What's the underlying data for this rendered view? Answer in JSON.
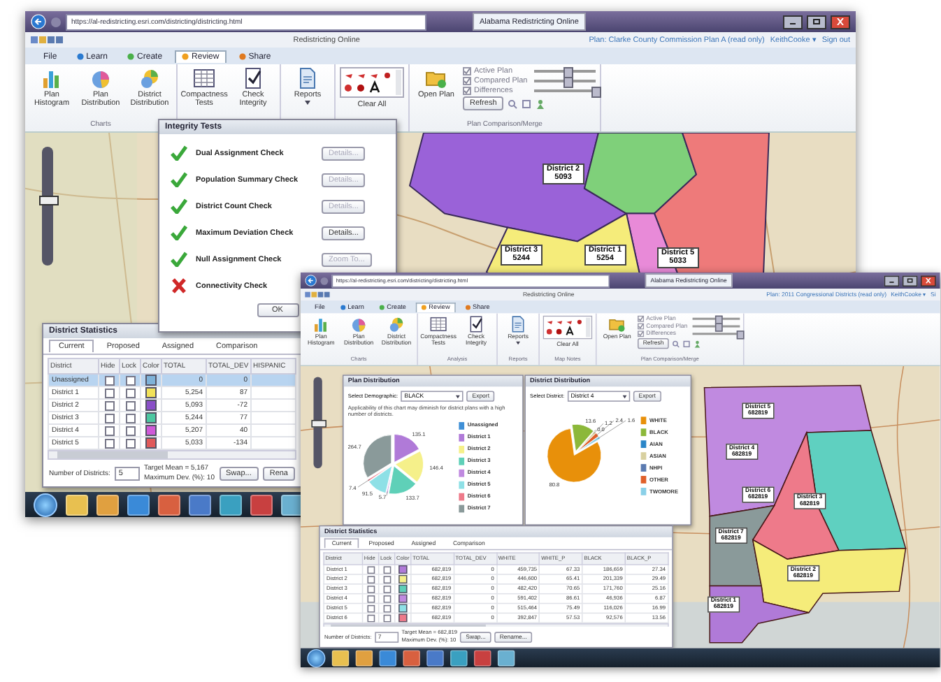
{
  "windows": [
    {
      "url": "https://al-redistricting.esri.com/districting/districting.html",
      "tab": "Alabama Redistricting Online",
      "app_title": "Redistricting Online",
      "plan": "Plan: Clarke County Commission Plan A (read only)",
      "user": "KeithCooke ▾",
      "sign_out": "Sign out",
      "menu": [
        {
          "label": "File",
          "selected": false
        },
        {
          "label": "Learn",
          "selected": false
        },
        {
          "label": "Create",
          "selected": false
        },
        {
          "label": "Review",
          "selected": true
        },
        {
          "label": "Share",
          "selected": false
        }
      ],
      "ribbon": [
        {
          "kind": "buttons",
          "group": "Charts",
          "buttons": [
            {
              "label": "Plan Histogram",
              "kind": "histogram"
            },
            {
              "label": "Plan Distribution",
              "kind": "pie"
            },
            {
              "label": "District Distribution",
              "kind": "pie-stack"
            }
          ]
        },
        {
          "kind": "buttons",
          "buttons": [
            {
              "label": "Compactness Tests",
              "kind": "table"
            },
            {
              "label": "Check Integrity",
              "kind": "check"
            }
          ]
        },
        {
          "kind": "buttons",
          "buttons": [
            {
              "label": "Reports",
              "kind": "report"
            }
          ]
        },
        {
          "kind": "notes",
          "clear": "Clear All"
        },
        {
          "kind": "compare",
          "group": "Plan Comparison/Merge",
          "open": "Open Plan",
          "refresh": "Refresh",
          "layers": [
            {
              "label": "Active Plan",
              "checked": true,
              "level": 0.55
            },
            {
              "label": "Compared Plan",
              "checked": true,
              "level": 0.55
            },
            {
              "label": "Differences",
              "checked": true,
              "level": 1
            }
          ]
        }
      ],
      "map": {
        "zoom": {
          "level": 0.55
        },
        "labels": [
          {
            "name": "District 2",
            "population": "5093"
          },
          {
            "name": "District 3",
            "population": "5244"
          },
          {
            "name": "District 1",
            "population": "5254"
          },
          {
            "name": "District 5",
            "population": "5033"
          }
        ]
      },
      "dialog": {
        "title": "Integrity Tests",
        "ok": "OK",
        "checks": [
          {
            "label": "Dual Assignment Check",
            "passed": true,
            "button": {
              "label": "Details...",
              "disabled": true
            }
          },
          {
            "label": "Population Summary Check",
            "passed": true,
            "button": {
              "label": "Details...",
              "disabled": true
            }
          },
          {
            "label": "District Count Check",
            "passed": true,
            "button": {
              "label": "Details...",
              "disabled": true
            }
          },
          {
            "label": "Maximum Deviation Check",
            "passed": true,
            "button": {
              "label": "Details...",
              "disabled": false
            }
          },
          {
            "label": "Null Assignment Check",
            "passed": true,
            "button": {
              "label": "Zoom To...",
              "disabled": true
            }
          },
          {
            "label": "Connectivity Check",
            "passed": false
          }
        ]
      },
      "stats": {
        "title": "District Statistics",
        "tabs": [
          {
            "label": "Current",
            "selected": true
          },
          {
            "label": "Proposed",
            "selected": false
          },
          {
            "label": "Assigned",
            "selected": false
          },
          {
            "label": "Comparison",
            "selected": false
          }
        ],
        "columns": [
          "District",
          "Hide",
          "Lock",
          "Color",
          "TOTAL",
          "TOTAL_DEV",
          "HISPANIC"
        ],
        "rows": [
          {
            "district": "Unassigned",
            "hide": false,
            "lock": false,
            "color": "#7fb2d8",
            "selected": true,
            "values": [
              "0",
              "0"
            ]
          },
          {
            "district": "District 1",
            "hide": false,
            "lock": false,
            "color": "#f2e25a",
            "selected": false,
            "values": [
              "5,254",
              "87"
            ]
          },
          {
            "district": "District 2",
            "hide": false,
            "lock": false,
            "color": "#8a4fc8",
            "selected": false,
            "values": [
              "5,093",
              "-72"
            ]
          },
          {
            "district": "District 3",
            "hide": false,
            "lock": false,
            "color": "#4cc7a0",
            "selected": false,
            "values": [
              "5,244",
              "77"
            ]
          },
          {
            "district": "District 4",
            "hide": false,
            "lock": false,
            "color": "#d05ad8",
            "selected": false,
            "values": [
              "5,207",
              "40"
            ]
          },
          {
            "district": "District 5",
            "hide": false,
            "lock": false,
            "color": "#e05a5a",
            "selected": false,
            "values": [
              "5,033",
              "-134"
            ]
          }
        ],
        "count_label": "Number of Districts:",
        "count": "5",
        "target": "Target Mean = 5,167",
        "deviation": "Maximum Dev. (%): 10",
        "buttons": [
          "Swap...",
          "Rena"
        ]
      }
    },
    {
      "url": "https://al-redistricting.esri.com/districting/districting.html",
      "tab": "Alabama Redistricting Online",
      "app_title": "Redistricting Online",
      "plan": "Plan: 2011 Congressional Districts (read only)",
      "user": "KeithCooke ▾",
      "sign_out": "Si",
      "menu": [
        {
          "label": "File",
          "selected": false
        },
        {
          "label": "Learn",
          "selected": false
        },
        {
          "label": "Create",
          "selected": false
        },
        {
          "label": "Review",
          "selected": true
        },
        {
          "label": "Share",
          "selected": false
        }
      ],
      "ribbon": [
        {
          "kind": "buttons",
          "group": "Charts",
          "buttons": [
            {
              "label": "Plan Histogram",
              "kind": "histogram"
            },
            {
              "label": "Plan Distribution",
              "kind": "pie"
            },
            {
              "label": "District Distribution",
              "kind": "pie-stack"
            }
          ]
        },
        {
          "kind": "buttons",
          "group": "Analysis",
          "buttons": [
            {
              "label": "Compactness Tests",
              "kind": "table"
            },
            {
              "label": "Check Integrity",
              "kind": "check"
            }
          ]
        },
        {
          "kind": "buttons",
          "group": "Reports",
          "buttons": [
            {
              "label": "Reports",
              "kind": "report"
            }
          ]
        },
        {
          "kind": "notes",
          "group": "Map Notes",
          "clear": "Clear All"
        },
        {
          "kind": "compare",
          "group": "Plan Comparison/Merge",
          "open": "Open Plan",
          "refresh": "Refresh",
          "layers": [
            {
              "label": "Active Plan",
              "checked": true,
              "level": 0.55
            },
            {
              "label": "Compared Plan",
              "checked": true,
              "level": 0.55
            },
            {
              "label": "Differences",
              "checked": true,
              "level": 1
            }
          ]
        }
      ],
      "map": {
        "zoom": {
          "level": 0.5
        },
        "labels": [
          {
            "name": "District 5",
            "population": "682819"
          },
          {
            "name": "District 4",
            "population": "682819"
          },
          {
            "name": "District 6",
            "population": "682819"
          },
          {
            "name": "District 3",
            "population": "682819"
          },
          {
            "name": "District 7",
            "population": "682819"
          },
          {
            "name": "District 2",
            "population": "682819"
          },
          {
            "name": "District 1",
            "population": "682819"
          }
        ]
      },
      "plan_distribution": {
        "title": "Plan Distribution",
        "select_label": "Select Demographic:",
        "select": "BLACK",
        "export": "Export",
        "note": "Applicability of this chart may diminish for district plans with a high number of districts.",
        "legend": [
          {
            "color": "#3f8fd6"
          },
          {
            "color": "#b07ad8"
          },
          {
            "color": "#f5f08a"
          },
          {
            "color": "#5fd0b8"
          },
          {
            "color": "#c08ae0"
          },
          {
            "color": "#8ee0e6"
          },
          {
            "color": "#ee7a8a"
          },
          {
            "color": "#8a9a9a"
          }
        ],
        "chart_data": {
          "type": "pie",
          "categories": [
            "Unassigned",
            "District 1",
            "District 2",
            "District 3",
            "District 4",
            "District 5",
            "District 6",
            "District 7"
          ],
          "values": [
            null,
            135.1,
            146.4,
            133.7,
            5.7,
            91.5,
            7.4,
            264.7
          ],
          "value_labels": [
            null,
            "135.1",
            "146.4",
            "133.7",
            "5.7",
            "91.5",
            "7.4",
            "264.7"
          ]
        }
      },
      "district_distribution": {
        "title": "District Distribution",
        "select_label": "Select District:",
        "select": "District 4",
        "export": "Export",
        "legend": [
          {
            "color": "#e8900a"
          },
          {
            "color": "#8cb83a"
          },
          {
            "color": "#2a86c8"
          },
          {
            "color": "#d8d0a0"
          },
          {
            "color": "#5a7ab0"
          },
          {
            "color": "#e0602a"
          },
          {
            "color": "#8ad0e8"
          }
        ],
        "chart_data": {
          "type": "pie",
          "categories": [
            "WHITE",
            "BLACK",
            "AIAN",
            "ASIAN",
            "NHPI",
            "OTHER",
            "TWOMORE"
          ],
          "values": [
            80.8,
            13.6,
            0.0,
            1.2,
            null,
            2.4,
            1.6
          ],
          "value_labels": [
            "80.8",
            "13.6",
            "0.0",
            "1.2",
            null,
            "2.4",
            "1.6"
          ]
        }
      },
      "stats": {
        "title": "District Statistics",
        "tabs": [
          {
            "label": "Current",
            "selected": true
          },
          {
            "label": "Proposed",
            "selected": false
          },
          {
            "label": "Assigned",
            "selected": false
          },
          {
            "label": "Comparison",
            "selected": false
          }
        ],
        "columns": [
          "District",
          "Hide",
          "Lock",
          "Color",
          "TOTAL",
          "TOTAL_DEV",
          "WHITE",
          "WHITE_P",
          "BLACK",
          "BLACK_P"
        ],
        "rows": [
          {
            "district": "District 1",
            "hide": false,
            "lock": false,
            "color": "#b07ad8",
            "selected": false,
            "values": [
              "682,819",
              "0",
              "459,735",
              "67.33",
              "186,659",
              "27.34"
            ]
          },
          {
            "district": "District 2",
            "hide": false,
            "lock": false,
            "color": "#f5f08a",
            "selected": false,
            "values": [
              "682,819",
              "0",
              "446,600",
              "65.41",
              "201,339",
              "29.49"
            ]
          },
          {
            "district": "District 3",
            "hide": false,
            "lock": false,
            "color": "#5fd0b8",
            "selected": false,
            "values": [
              "682,819",
              "0",
              "482,420",
              "70.65",
              "171,760",
              "25.16"
            ]
          },
          {
            "district": "District 4",
            "hide": false,
            "lock": false,
            "color": "#c08ae0",
            "selected": false,
            "values": [
              "682,819",
              "0",
              "591,402",
              "86.61",
              "46,936",
              "6.87"
            ]
          },
          {
            "district": "District 5",
            "hide": false,
            "lock": false,
            "color": "#8ee0e6",
            "selected": false,
            "values": [
              "682,819",
              "0",
              "515,464",
              "75.49",
              "116,026",
              "16.99"
            ]
          },
          {
            "district": "District 6",
            "hide": false,
            "lock": false,
            "color": "#ee7a8a",
            "selected": false,
            "values": [
              "682,819",
              "0",
              "392,847",
              "57.53",
              "92,576",
              "13.56"
            ]
          }
        ],
        "count_label": "Number of Districts:",
        "count": "7",
        "target": "Target Mean = 682,819",
        "deviation": "Maximum Dev. (%): 10",
        "buttons": [
          "Swap...",
          "Rename..."
        ]
      }
    }
  ]
}
